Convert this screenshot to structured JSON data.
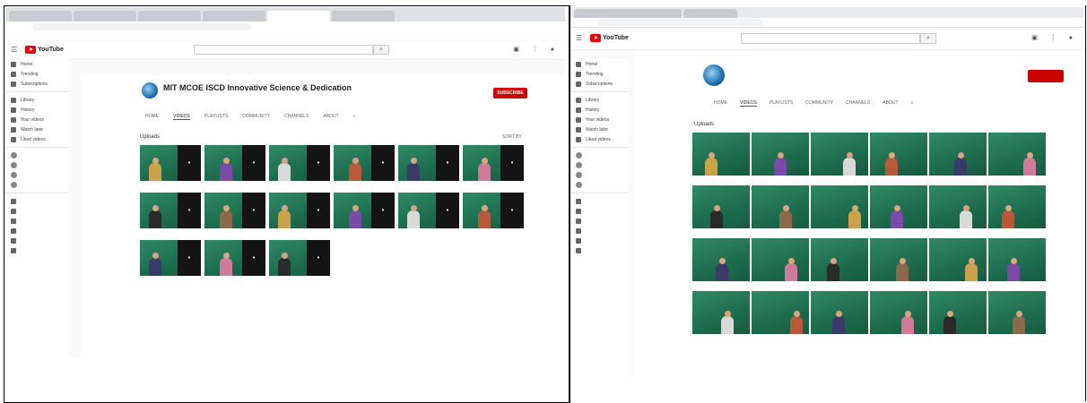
{
  "left": {
    "tabs": [
      "",
      "",
      "",
      "",
      "",
      ""
    ],
    "url": "",
    "bookmarks": "",
    "search_placeholder": "",
    "channel_name": "MIT MCOE ISCD Innovative Science & Dedication",
    "subscribers": "",
    "subscribe_label": "SUBSCRIBE",
    "channel_tabs": [
      "HOME",
      "VIDEOS",
      "PLAYLISTS",
      "COMMUNITY",
      "CHANNELS",
      "ABOUT"
    ],
    "section_title": "Uploads",
    "sort_label": "SORT BY",
    "sidebar_groups": [
      [
        "Home",
        "Trending",
        "Subscriptions"
      ],
      [
        "Library",
        "History",
        "Your videos",
        "Watch later",
        "Liked videos"
      ],
      [
        "",
        "",
        "",
        ""
      ],
      [
        "",
        "",
        "",
        "",
        "",
        ""
      ]
    ],
    "videos": [
      {
        "title": "",
        "meta": ""
      },
      {
        "title": "",
        "meta": ""
      },
      {
        "title": "",
        "meta": ""
      },
      {
        "title": "",
        "meta": ""
      },
      {
        "title": "",
        "meta": ""
      },
      {
        "title": "",
        "meta": ""
      },
      {
        "title": "",
        "meta": ""
      },
      {
        "title": "",
        "meta": ""
      },
      {
        "title": "",
        "meta": ""
      },
      {
        "title": "",
        "meta": ""
      },
      {
        "title": "",
        "meta": ""
      },
      {
        "title": "",
        "meta": ""
      },
      {
        "title": "",
        "meta": ""
      },
      {
        "title": "",
        "meta": ""
      },
      {
        "title": "",
        "meta": ""
      }
    ]
  },
  "right": {
    "tabs": [
      "",
      ""
    ],
    "url": "",
    "search_placeholder": "",
    "channel_name": "",
    "subscribers": "",
    "subscribe_label": "",
    "channel_tabs": [
      "HOME",
      "VIDEOS",
      "PLAYLISTS",
      "COMMUNITY",
      "CHANNELS",
      "ABOUT"
    ],
    "section_title": "Uploads",
    "sort_label": "",
    "sidebar_groups": [
      [
        "Home",
        "Trending",
        "Subscriptions"
      ],
      [
        "Library",
        "History",
        "Your videos",
        "Watch later",
        "Liked videos"
      ],
      [
        "",
        "",
        "",
        ""
      ],
      [
        "",
        "",
        "",
        "",
        "",
        ""
      ]
    ],
    "videos": [
      {
        "title": "",
        "meta": ""
      },
      {
        "title": "",
        "meta": ""
      },
      {
        "title": "",
        "meta": ""
      },
      {
        "title": "",
        "meta": ""
      },
      {
        "title": "",
        "meta": ""
      },
      {
        "title": "",
        "meta": ""
      },
      {
        "title": "",
        "meta": ""
      },
      {
        "title": "",
        "meta": ""
      },
      {
        "title": "",
        "meta": ""
      },
      {
        "title": "",
        "meta": ""
      },
      {
        "title": "",
        "meta": ""
      },
      {
        "title": "",
        "meta": ""
      },
      {
        "title": "",
        "meta": ""
      },
      {
        "title": "",
        "meta": ""
      },
      {
        "title": "",
        "meta": ""
      },
      {
        "title": "",
        "meta": ""
      },
      {
        "title": "",
        "meta": ""
      },
      {
        "title": "",
        "meta": ""
      },
      {
        "title": "",
        "meta": ""
      },
      {
        "title": "",
        "meta": ""
      },
      {
        "title": "",
        "meta": ""
      },
      {
        "title": "",
        "meta": ""
      },
      {
        "title": "",
        "meta": ""
      },
      {
        "title": "",
        "meta": ""
      }
    ]
  },
  "colors": {
    "accent": "#cc0000",
    "board": "#2a7d5c"
  }
}
